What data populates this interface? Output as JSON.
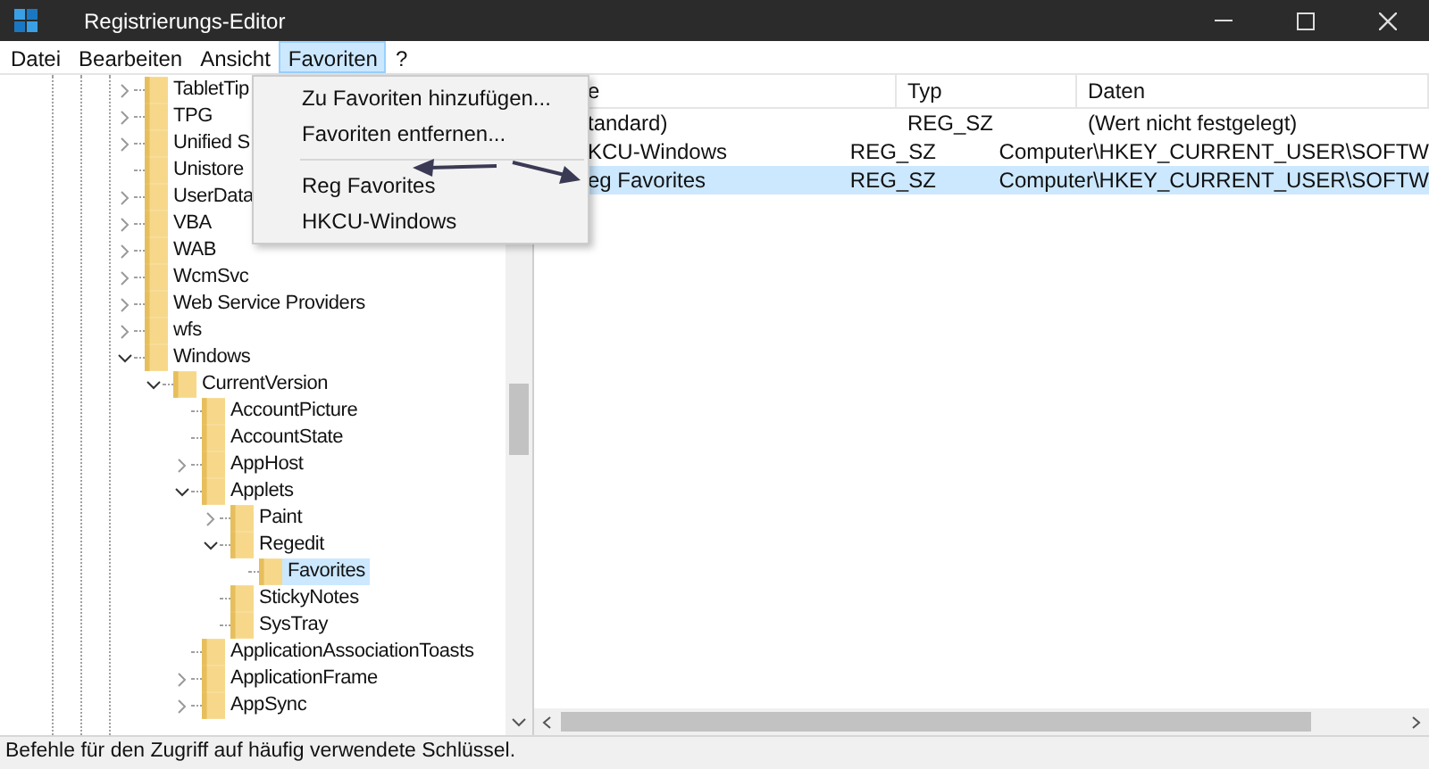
{
  "window": {
    "title": "Registrierungs-Editor"
  },
  "menu_bar": [
    {
      "label": "Datei",
      "selected": false
    },
    {
      "label": "Bearbeiten",
      "selected": false
    },
    {
      "label": "Ansicht",
      "selected": false
    },
    {
      "label": "Favoriten",
      "selected": true
    },
    {
      "label": "?",
      "selected": false
    }
  ],
  "open_menu": {
    "items": [
      {
        "kind": "item",
        "label": "Zu Favoriten hinzufügen..."
      },
      {
        "kind": "item",
        "label": "Favoriten entfernen..."
      },
      {
        "kind": "separator"
      },
      {
        "kind": "item",
        "label": "Reg Favorites"
      },
      {
        "kind": "item",
        "label": "HKCU-Windows"
      }
    ]
  },
  "tree": {
    "items": [
      {
        "label": "TabletTip",
        "expanded": false,
        "selected": false
      },
      {
        "label": "TPG",
        "expanded": false,
        "selected": false
      },
      {
        "label": "Unified S",
        "expanded": false,
        "selected": false
      },
      {
        "label": "Unistore",
        "selected": false
      },
      {
        "label": "UserData",
        "expanded": false,
        "selected": false
      },
      {
        "label": "VBA",
        "expanded": false,
        "selected": false
      },
      {
        "label": "WAB",
        "expanded": false,
        "selected": false
      },
      {
        "label": "WcmSvc",
        "expanded": false,
        "selected": false
      },
      {
        "label": "Web Service Providers",
        "expanded": false,
        "selected": false
      },
      {
        "label": "wfs",
        "expanded": false,
        "selected": false
      },
      {
        "label": "Windows",
        "expanded": true,
        "selected": false,
        "children": [
          {
            "label": "CurrentVersion",
            "expanded": true,
            "selected": false,
            "children": [
              {
                "label": "AccountPicture",
                "selected": false
              },
              {
                "label": "AccountState",
                "selected": false
              },
              {
                "label": "AppHost",
                "expanded": false,
                "selected": false
              },
              {
                "label": "Applets",
                "expanded": true,
                "selected": false,
                "children": [
                  {
                    "label": "Paint",
                    "expanded": false,
                    "selected": false
                  },
                  {
                    "label": "Regedit",
                    "expanded": true,
                    "selected": false,
                    "children": [
                      {
                        "label": "Favorites",
                        "selected": true
                      }
                    ]
                  },
                  {
                    "label": "StickyNotes",
                    "selected": false
                  },
                  {
                    "label": "SysTray",
                    "selected": false
                  }
                ]
              },
              {
                "label": "ApplicationAssociationToasts",
                "selected": false
              },
              {
                "label": "ApplicationFrame",
                "expanded": false,
                "selected": false
              },
              {
                "label": "AppSync",
                "expanded": false,
                "selected": false
              }
            ]
          }
        ]
      }
    ]
  },
  "values": {
    "columns": [
      "e",
      "Typ",
      "Daten"
    ],
    "rows": [
      {
        "name": "tandard)",
        "type": "REG_SZ",
        "data": "(Wert nicht festgelegt)",
        "selected": false
      },
      {
        "name": "KCU-Windows",
        "type": "REG_SZ",
        "data": "Computer\\HKEY_CURRENT_USER\\SOFTW",
        "selected": false
      },
      {
        "name": "eg Favorites",
        "type": "REG_SZ",
        "data": "Computer\\HKEY_CURRENT_USER\\SOFTW",
        "selected": true
      }
    ]
  },
  "status_bar": "Befehle für den Zugriff auf häufig verwendete Schlüssel."
}
